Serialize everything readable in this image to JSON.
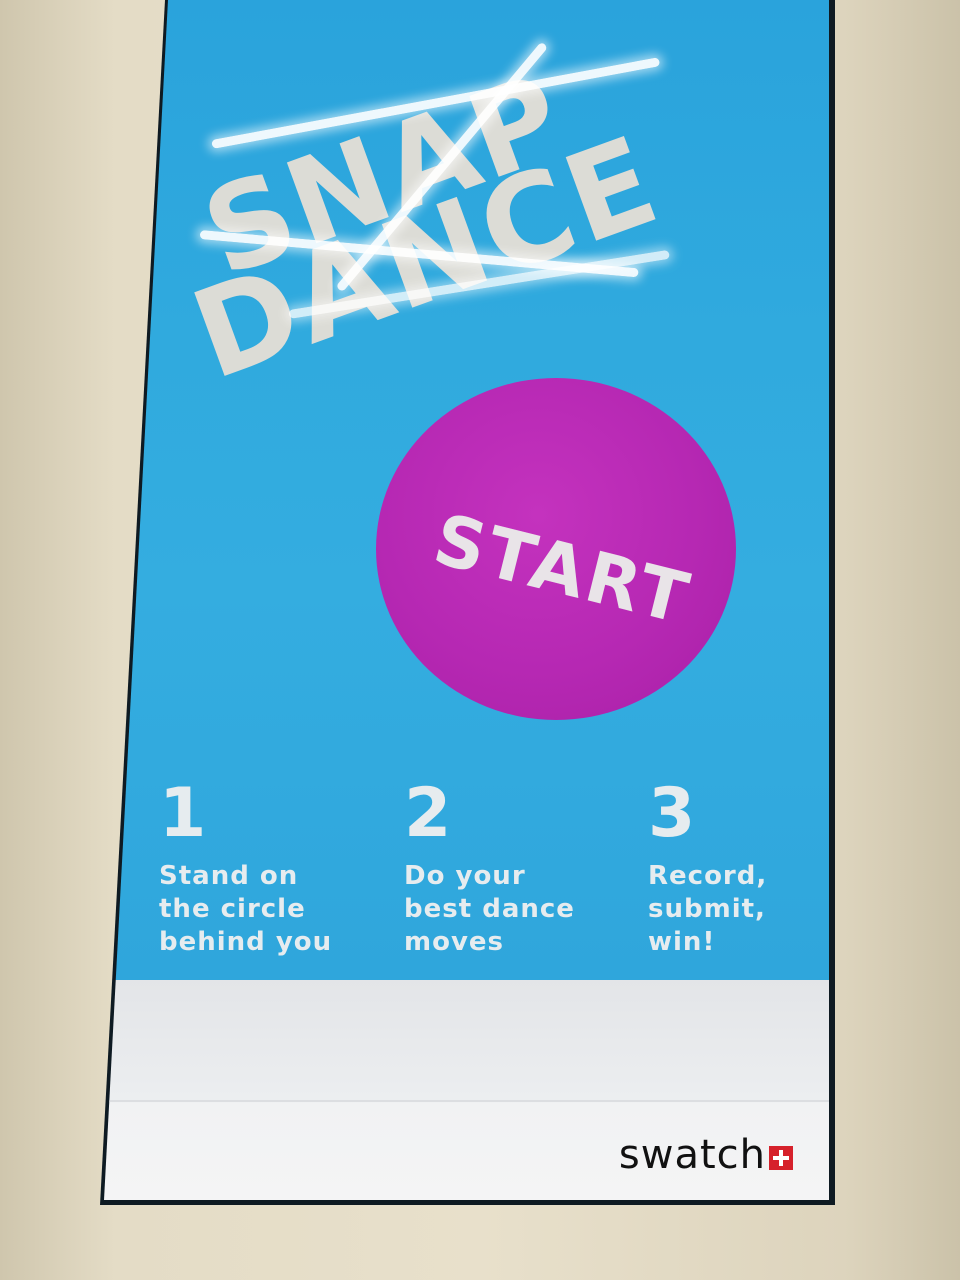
{
  "title": {
    "line1": "SNAP",
    "line2": "DANCE"
  },
  "start_button": {
    "label": "START"
  },
  "steps": [
    {
      "number": "1",
      "text": "Stand on\nthe circle\nbehind you"
    },
    {
      "number": "2",
      "text": "Do your\nbest dance\nmoves"
    },
    {
      "number": "3",
      "text": "Record,\nsubmit,\nwin!"
    }
  ],
  "brand": {
    "logo_text": "swatch",
    "logo_icon": "swiss-cross-icon"
  },
  "colors": {
    "background": "#30aade",
    "start_button": "#b628b3",
    "text": "#e6ecef",
    "logo_cross": "#d6212b"
  }
}
